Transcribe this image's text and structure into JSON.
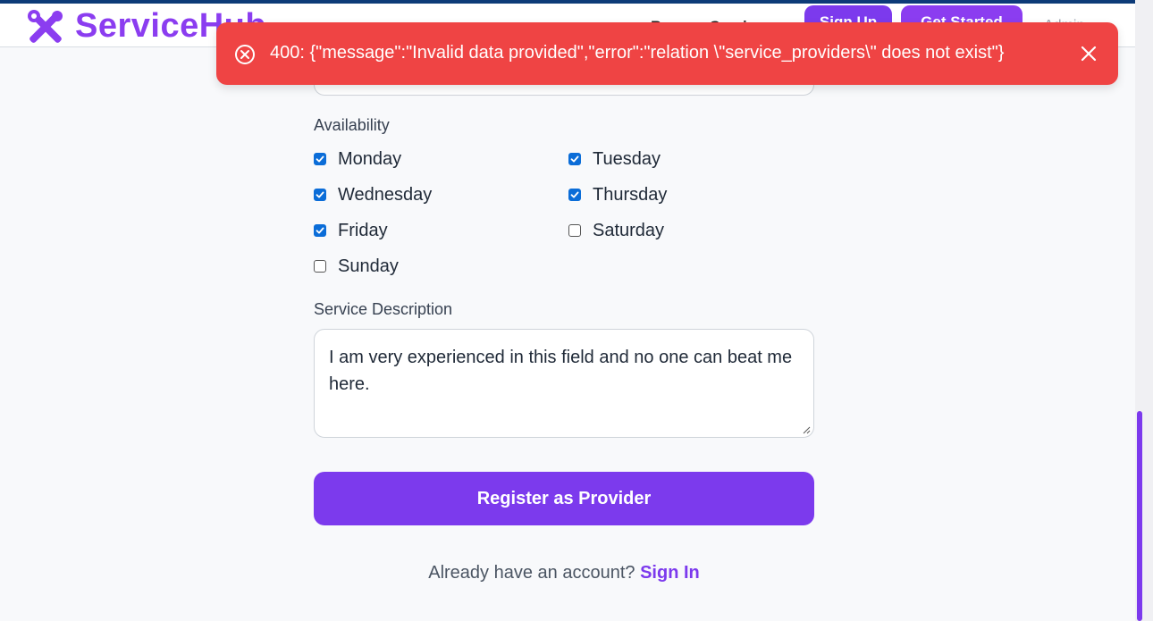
{
  "header": {
    "logo_text": "ServiceHub",
    "browse_label": "Browse Services",
    "signup_label": "Sign Up",
    "get_started_label": "Get Started",
    "admin_label": "Admin",
    "brand_color": "#8b3df0"
  },
  "toast": {
    "message": "400: {\"message\":\"Invalid data provided\",\"error\":\"relation \\\"service_providers\\\" does not exist\"}",
    "background": "#ef4444",
    "icon": "error-circle-icon",
    "close_icon": "close-icon"
  },
  "form": {
    "availability_label": "Availability",
    "days": [
      {
        "label": "Monday",
        "checked": true
      },
      {
        "label": "Tuesday",
        "checked": true
      },
      {
        "label": "Wednesday",
        "checked": true
      },
      {
        "label": "Thursday",
        "checked": true
      },
      {
        "label": "Friday",
        "checked": true
      },
      {
        "label": "Saturday",
        "checked": false
      },
      {
        "label": "Sunday",
        "checked": false
      }
    ],
    "description_label": "Service Description",
    "description_value": "I am very experienced in this field and no one can beat me here.",
    "submit_label": "Register as Provider",
    "signin_prompt": "Already have an account?",
    "signin_link": "Sign In",
    "accent": "#7c3aed"
  }
}
